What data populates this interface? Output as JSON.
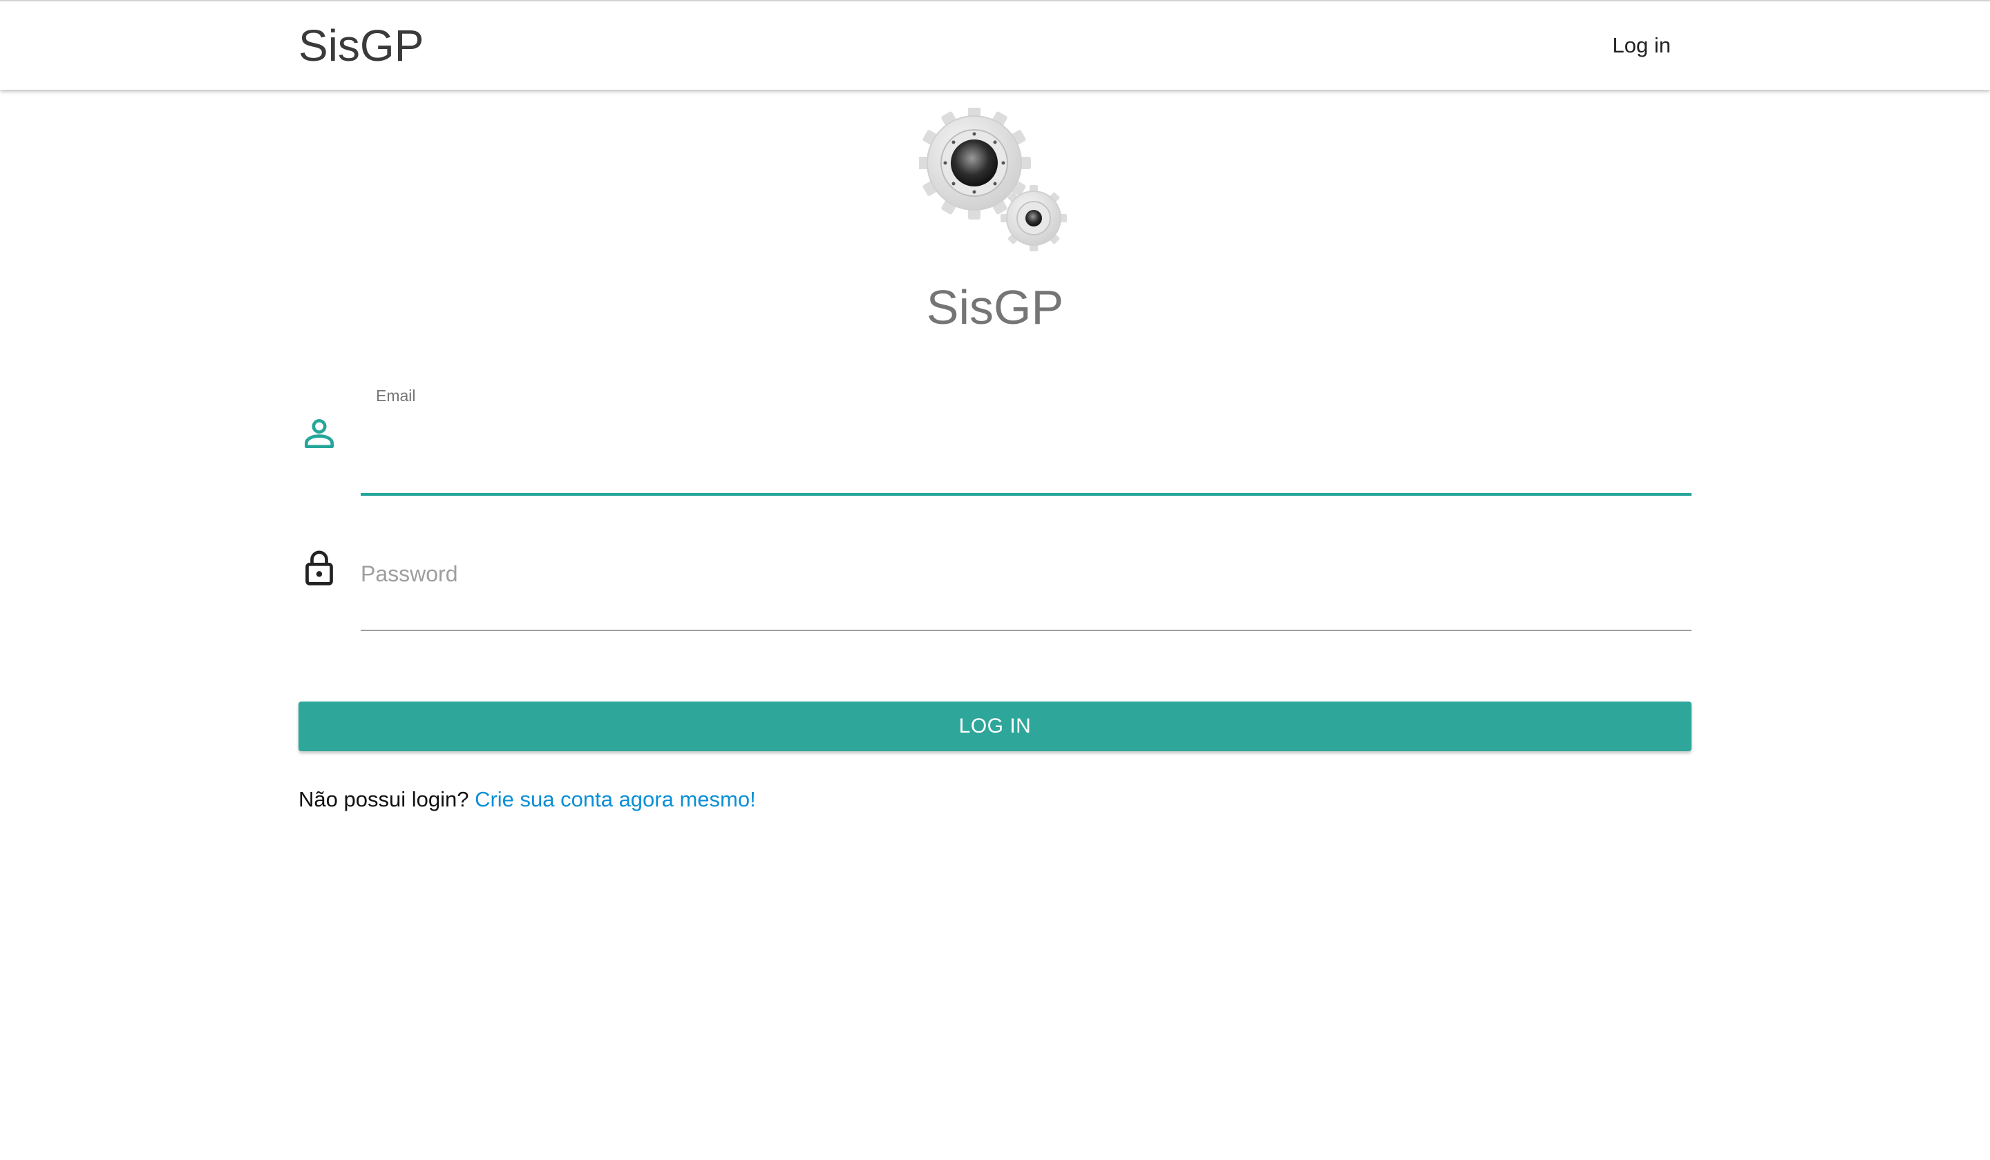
{
  "navbar": {
    "brand": "SisGP",
    "login_link": "Log in"
  },
  "main": {
    "title": "SisGP",
    "email_label": "Email",
    "email_value": "",
    "password_placeholder": "Password",
    "login_button": "LOG IN",
    "signup_prompt": "Não possui login?",
    "signup_link": "Crie sua conta agora mesmo!"
  },
  "icons": {
    "logo": "gears-logo",
    "email": "user-icon",
    "password": "lock-icon"
  },
  "colors": {
    "accent": "#26a69a",
    "link": "#0b8fd6",
    "title": "#757575"
  }
}
